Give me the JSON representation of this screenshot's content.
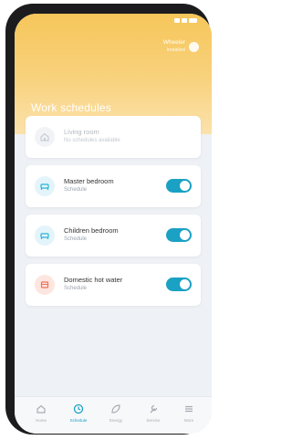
{
  "app": {
    "header_right": {
      "line1": "Wheeler",
      "line2": "Installed"
    },
    "page_title": "Work schedules"
  },
  "schedules": [
    {
      "title": "Living room",
      "subtitle": "No schedules available",
      "icon": "home-icon",
      "enabled": false,
      "accent": "#c9ced6"
    },
    {
      "title": "Master bedroom",
      "subtitle": "Schedule",
      "icon": "bed-icon",
      "enabled": true,
      "accent": "#29b3d8"
    },
    {
      "title": "Children bedroom",
      "subtitle": "Schedule",
      "icon": "bed-icon",
      "enabled": true,
      "accent": "#29b3d8"
    },
    {
      "title": "Domestic hot water",
      "subtitle": "Schedule",
      "icon": "hot-water-icon",
      "enabled": true,
      "accent": "#ef6f55"
    }
  ],
  "tabs": [
    {
      "label": "Home",
      "icon": "home-icon",
      "active": false
    },
    {
      "label": "Schedule",
      "icon": "clock-icon",
      "active": true
    },
    {
      "label": "Energy",
      "icon": "leaf-icon",
      "active": false
    },
    {
      "label": "Service",
      "icon": "wrench-icon",
      "active": false
    },
    {
      "label": "More",
      "icon": "menu-icon",
      "active": false
    }
  ],
  "colors": {
    "accent": "#1aa1c4",
    "header": "#f6c65a",
    "background": "#eef1f5"
  }
}
